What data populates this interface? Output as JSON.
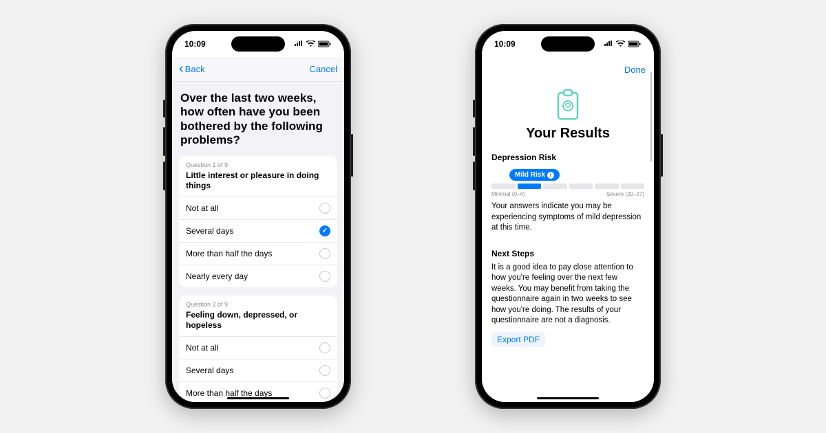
{
  "status": {
    "time": "10:09"
  },
  "phoneA": {
    "nav": {
      "back": "Back",
      "cancel": "Cancel"
    },
    "heading": "Over the last two weeks, how often have you been bothered by the following problems?",
    "options": [
      "Not at all",
      "Several days",
      "More than half the days",
      "Nearly every day"
    ],
    "q1": {
      "num": "Question 1 of 9",
      "text": "Little interest or pleasure in doing things",
      "selected": 1
    },
    "q2": {
      "num": "Question 2 of 9",
      "text": "Feeling down, depressed, or hopeless",
      "selected": -1
    }
  },
  "phoneB": {
    "nav": {
      "done": "Done"
    },
    "title": "Your Results",
    "risk": {
      "label": "Depression Risk",
      "pill": "Mild Risk",
      "minLabel": "Minimal (0–4)",
      "maxLabel": "Severe (20–27)",
      "summary": "Your answers indicate you may be experiencing symptoms of mild depression at this time."
    },
    "next": {
      "label": "Next Steps",
      "body": "It is a good idea to pay close attention to how you're feeling over the next few weeks. You may benefit from taking the questionnaire again in two weeks to see how you're doing. The results of your questionnaire are not a diagnosis.",
      "export": "Export PDF"
    }
  }
}
